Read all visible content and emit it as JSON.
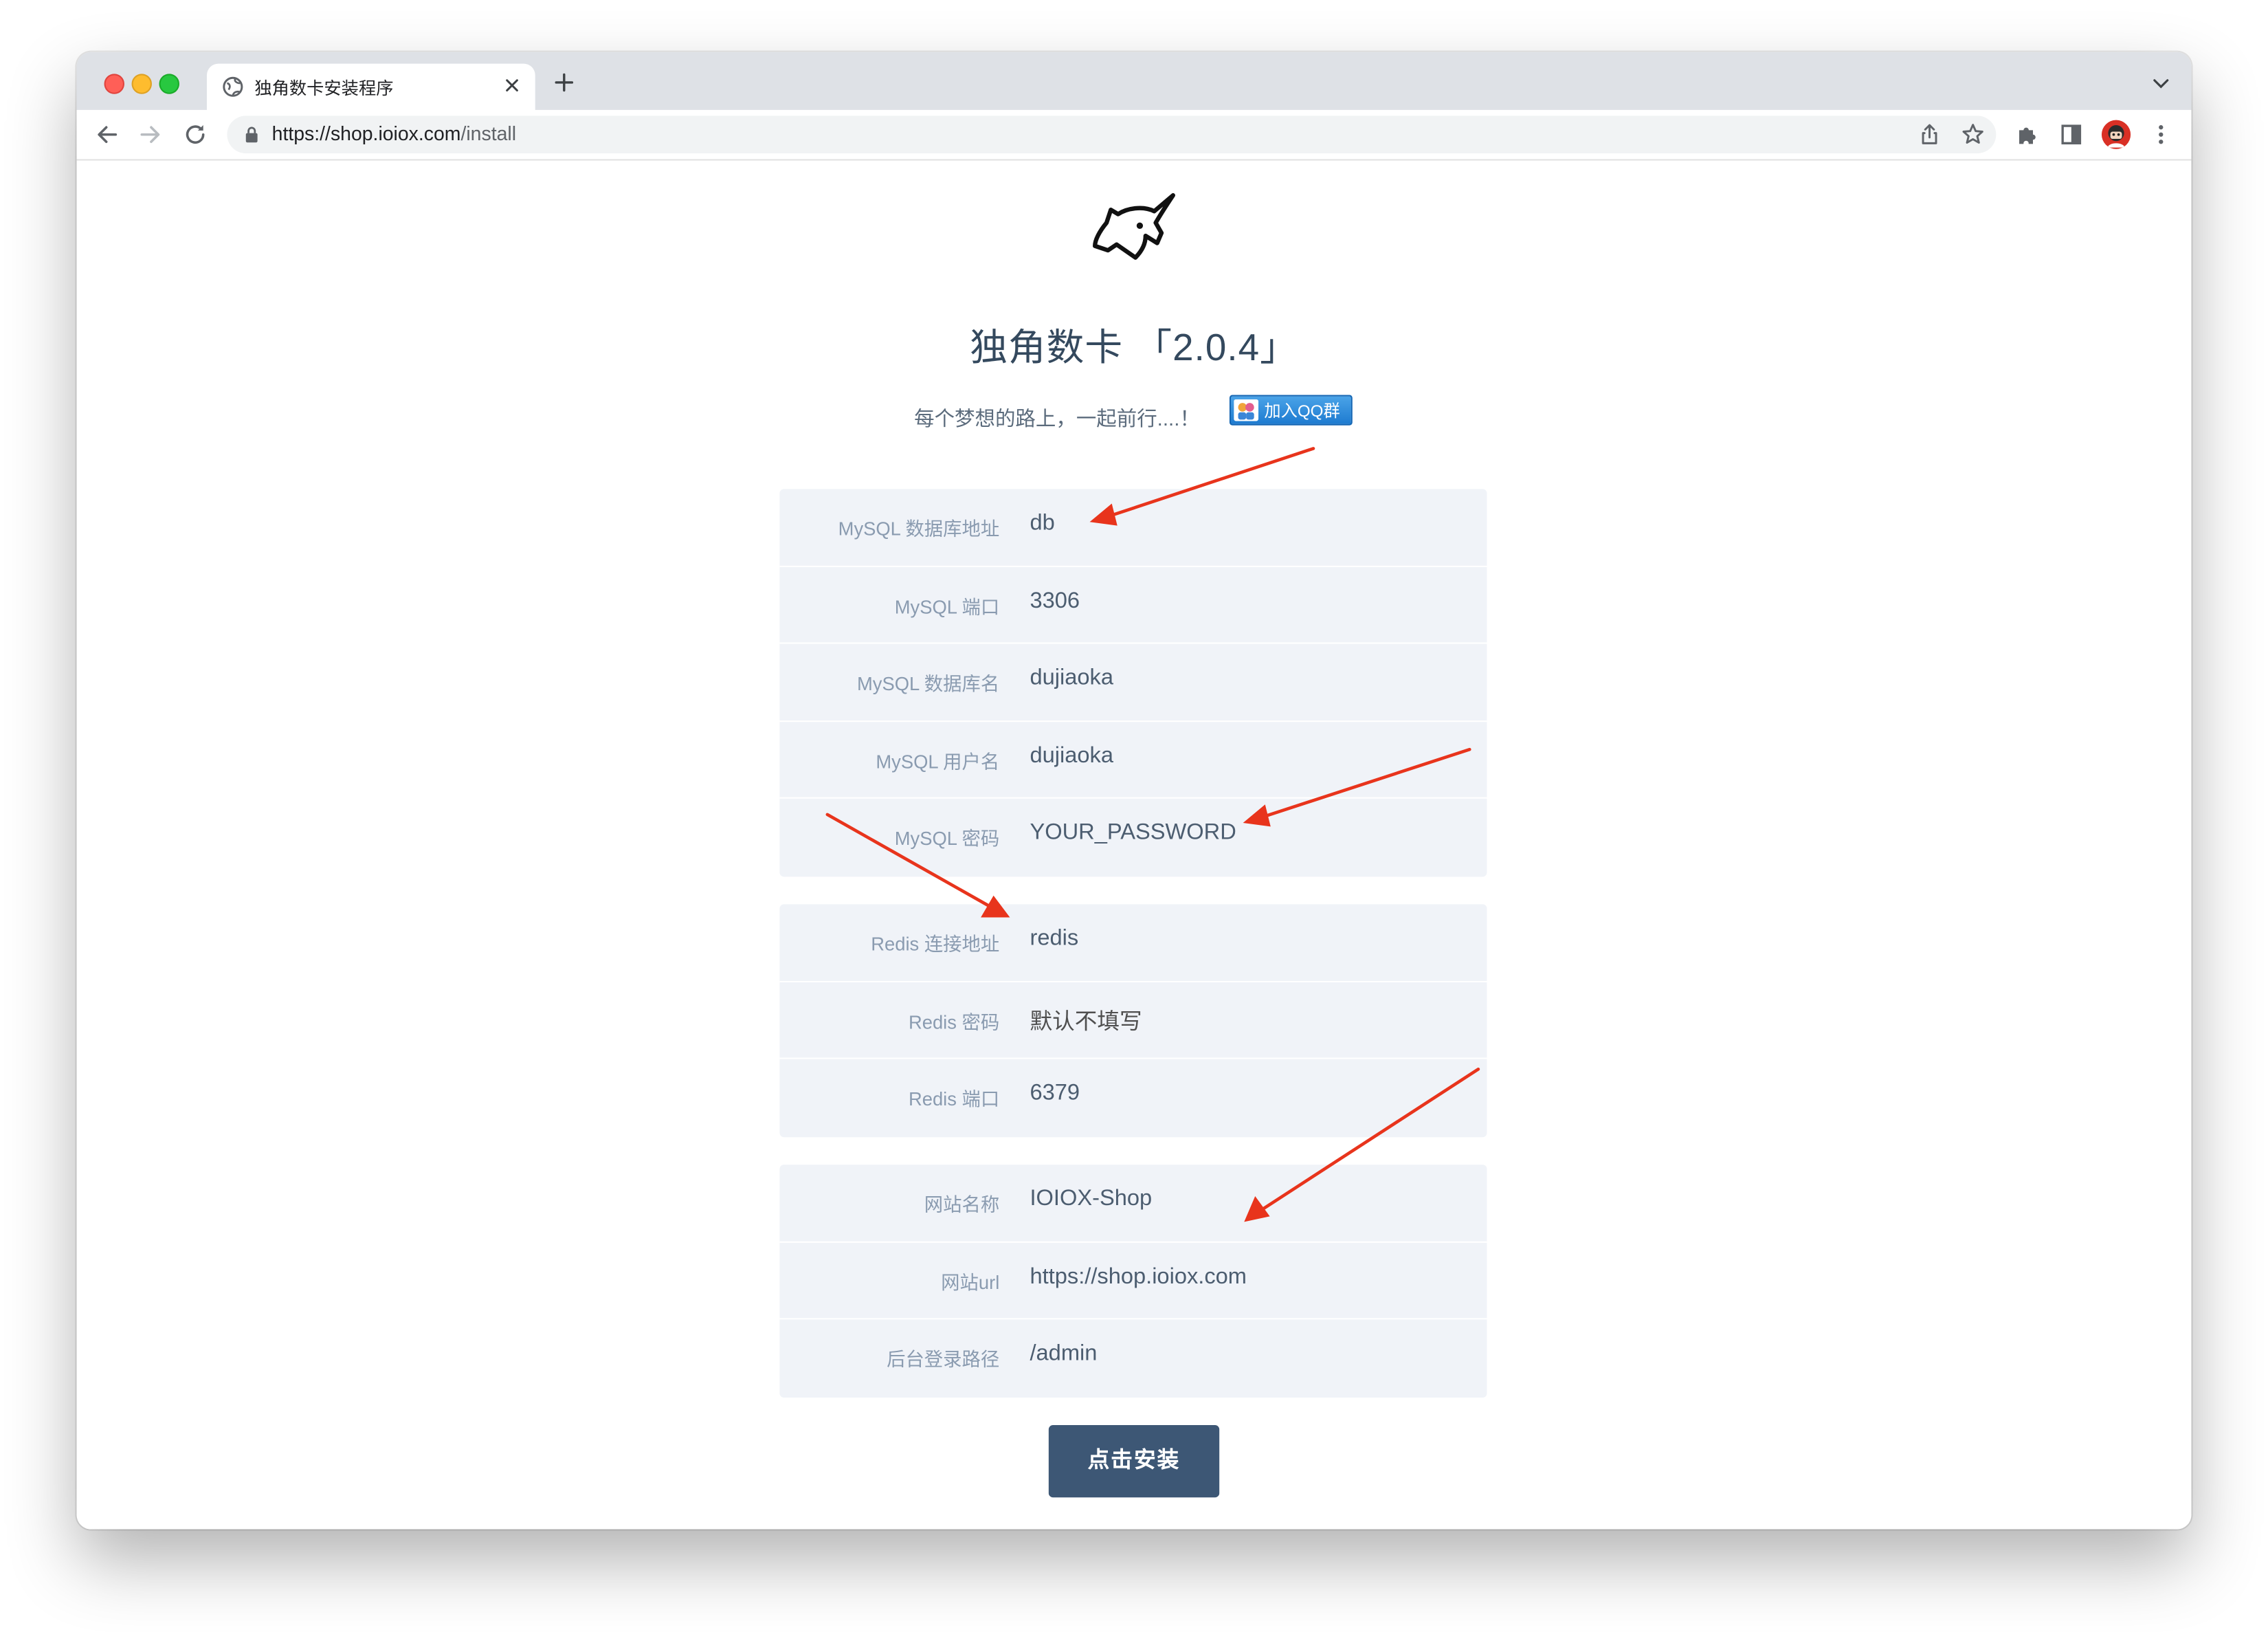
{
  "browser": {
    "tab_title": "独角数卡安装程序",
    "url_host": "https://shop.ioiox.com",
    "url_path": "/install"
  },
  "page": {
    "title": "独角数卡 「2.0.4」",
    "subtitle": "每个梦想的路上，一起前行....！",
    "qq_badge": "加入QQ群",
    "install_button": "点击安装"
  },
  "form": {
    "mysql": [
      {
        "label": "MySQL 数据库地址",
        "value": "db"
      },
      {
        "label": "MySQL 端口",
        "value": "3306"
      },
      {
        "label": "MySQL 数据库名",
        "value": "dujiaoka"
      },
      {
        "label": "MySQL 用户名",
        "value": "dujiaoka"
      },
      {
        "label": "MySQL 密码",
        "value": "YOUR_PASSWORD"
      }
    ],
    "redis": [
      {
        "label": "Redis 连接地址",
        "value": "redis"
      },
      {
        "label": "Redis 密码",
        "value": "默认不填写"
      },
      {
        "label": "Redis 端口",
        "value": "6379"
      }
    ],
    "site": [
      {
        "label": "网站名称",
        "value": "IOIOX-Shop"
      },
      {
        "label": "网站url",
        "value": "https://shop.ioiox.com"
      },
      {
        "label": "后台登录路径",
        "value": "/admin"
      }
    ]
  },
  "colors": {
    "accent": "#3d5775",
    "form_background": "#f0f3f8",
    "annotation_arrow": "#e8341c"
  },
  "icons": [
    "globe-icon",
    "close-icon",
    "plus-icon",
    "chevron-down-icon",
    "back-arrow-icon",
    "forward-arrow-icon",
    "reload-icon",
    "lock-icon",
    "share-icon",
    "star-icon",
    "puzzle-icon",
    "side-panel-icon",
    "avatar",
    "more-vert-icon",
    "unicorn-logo-icon",
    "qq-icon"
  ]
}
